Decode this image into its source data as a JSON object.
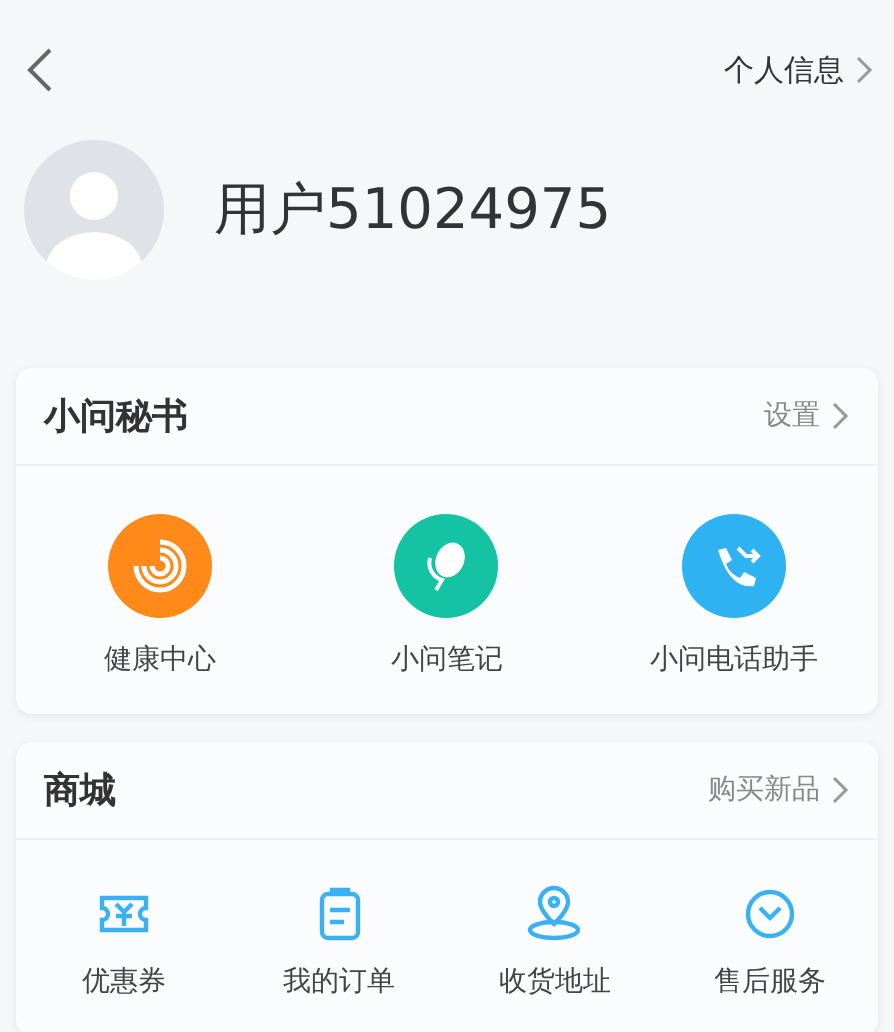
{
  "header": {
    "profile_link": "个人信息"
  },
  "user": {
    "name": "用户51024975"
  },
  "sections": [
    {
      "title": "小问秘书",
      "action": "设置",
      "items": [
        {
          "label": "健康中心",
          "color": "#ff8a1a"
        },
        {
          "label": "小问笔记",
          "color": "#14c3a4"
        },
        {
          "label": "小问电话助手",
          "color": "#2fb2f2"
        }
      ]
    },
    {
      "title": "商城",
      "action": "购买新品",
      "items": [
        {
          "label": "优惠券",
          "color": "#3ab0f5"
        },
        {
          "label": "我的订单",
          "color": "#3ab0f5"
        },
        {
          "label": "收货地址",
          "color": "#3ab0f5"
        },
        {
          "label": "售后服务",
          "color": "#3ab0f5"
        }
      ]
    }
  ]
}
